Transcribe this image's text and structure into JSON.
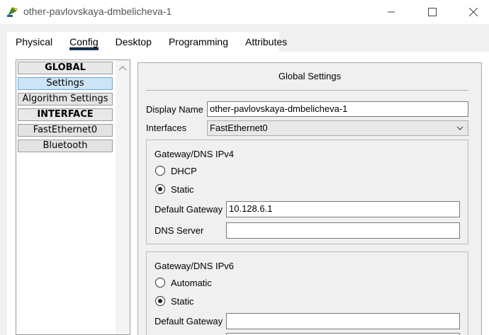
{
  "window": {
    "title": "other-pavlovskaya-dmbelicheva-1",
    "minimize_icon": "minimize-icon",
    "maximize_icon": "maximize-icon",
    "close_icon": "close-icon"
  },
  "tabs": [
    {
      "label": "Physical"
    },
    {
      "label": "Config",
      "active": true
    },
    {
      "label": "Desktop"
    },
    {
      "label": "Programming"
    },
    {
      "label": "Attributes"
    }
  ],
  "sidebar": {
    "items": [
      {
        "label": "GLOBAL",
        "type": "header"
      },
      {
        "label": "Settings",
        "type": "item",
        "selected": true
      },
      {
        "label": "Algorithm Settings",
        "type": "item"
      },
      {
        "label": "INTERFACE",
        "type": "header"
      },
      {
        "label": "FastEthernet0",
        "type": "item"
      },
      {
        "label": "Bluetooth",
        "type": "item"
      }
    ]
  },
  "global_settings": {
    "title": "Global Settings",
    "display_name_label": "Display Name",
    "display_name_value": "other-pavlovskaya-dmbelicheva-1",
    "interfaces_label": "Interfaces",
    "interfaces_value": "FastEthernet0"
  },
  "ipv4": {
    "title": "Gateway/DNS IPv4",
    "dhcp_label": "DHCP",
    "static_label": "Static",
    "selected": "Static",
    "default_gateway_label": "Default Gateway",
    "default_gateway_value": "10.128.6.1",
    "dns_server_label": "DNS Server",
    "dns_server_value": ""
  },
  "ipv6": {
    "title": "Gateway/DNS IPv6",
    "automatic_label": "Automatic",
    "static_label": "Static",
    "selected": "Static",
    "default_gateway_label": "Default Gateway",
    "default_gateway_value": ""
  },
  "colors": {
    "selected_item": "#cce4f7",
    "tab_underline": "#1b3a5c"
  }
}
